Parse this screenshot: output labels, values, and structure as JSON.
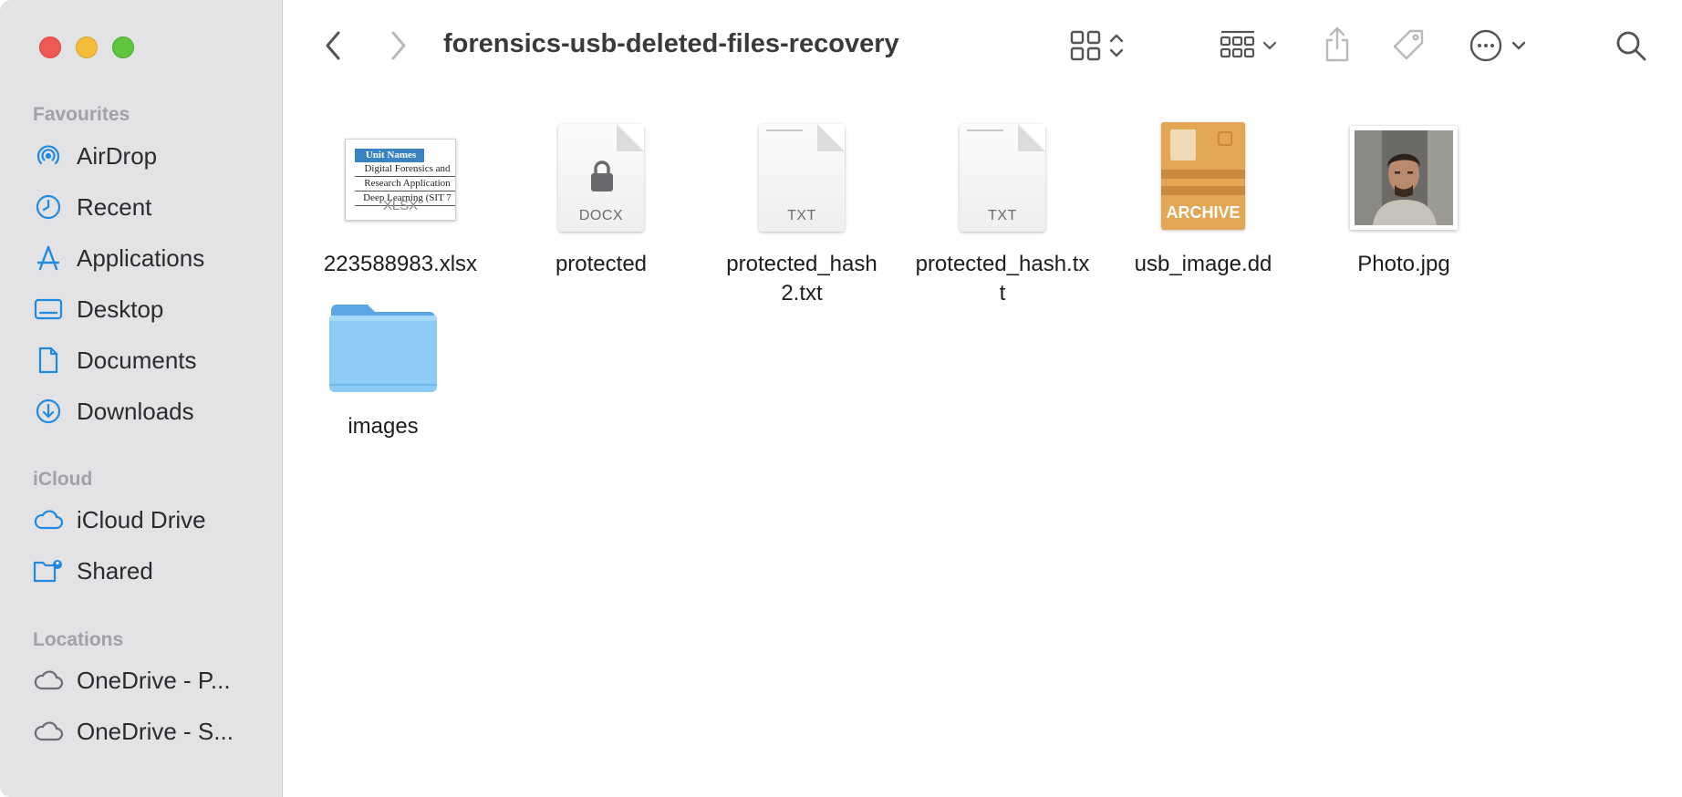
{
  "window": {
    "title": "forensics-usb-deleted-files-recovery"
  },
  "sidebar": {
    "favourites_heading": "Favourites",
    "favourites": [
      {
        "label": "AirDrop",
        "icon": "airdrop-icon"
      },
      {
        "label": "Recent",
        "icon": "clock-icon"
      },
      {
        "label": "Applications",
        "icon": "applications-icon"
      },
      {
        "label": "Desktop",
        "icon": "desktop-icon"
      },
      {
        "label": "Documents",
        "icon": "document-icon"
      },
      {
        "label": "Downloads",
        "icon": "download-icon"
      }
    ],
    "icloud_heading": "iCloud",
    "icloud": [
      {
        "label": "iCloud Drive",
        "icon": "icloud-icon"
      },
      {
        "label": "Shared",
        "icon": "shared-folder-icon"
      }
    ],
    "locations_heading": "Locations",
    "locations": [
      {
        "label": "OneDrive - P...",
        "icon": "cloud-icon"
      },
      {
        "label": "OneDrive - S...",
        "icon": "cloud-icon"
      }
    ]
  },
  "files": [
    {
      "name": "223588983.xlsx",
      "type": "xlsx",
      "ext_label": "XLSX",
      "preview_rows": [
        "Unit Names",
        "Digital Forensics and",
        "Research Application",
        "Deep Learning (SIT 7"
      ]
    },
    {
      "name": "protected",
      "type": "docx",
      "ext_label": "DOCX"
    },
    {
      "name": "protected_hash2.txt",
      "type": "txt",
      "ext_label": "TXT"
    },
    {
      "name": "protected_hash.txt",
      "type": "txt",
      "ext_label": "TXT"
    },
    {
      "name": "usb_image.dd",
      "type": "archive",
      "ext_label": "ARCHIVE"
    },
    {
      "name": "Photo.jpg",
      "type": "image"
    },
    {
      "name": "images",
      "type": "folder"
    }
  ],
  "colors": {
    "accent": "#1f8ae0",
    "sidebar_bg": "#e3e3e6",
    "folder": "#7ec2f2",
    "archive": "#e3a652"
  }
}
